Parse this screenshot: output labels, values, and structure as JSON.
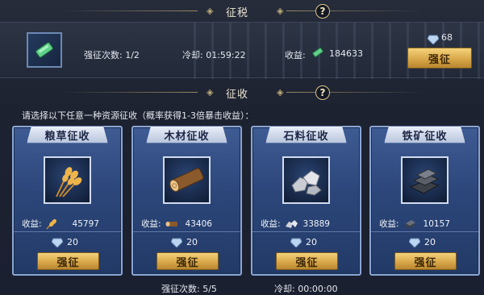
{
  "tax_section": {
    "title": "征税",
    "help_label": "?",
    "count_label": "强征次数: 1/2",
    "cooldown_label": "冷却: 01:59:22",
    "income_label": "收益:",
    "income_value": "184633",
    "cost_value": "68",
    "button_label": "强征",
    "icon": "silver-ingot-icon"
  },
  "levy_section": {
    "title": "征收",
    "help_label": "?",
    "prompt": "请选择以下任意一种资源征收（概率获得1-3倍暴击收益）：",
    "cards": [
      {
        "title": "粮草征收",
        "yield_label": "收益:",
        "yield_value": "45797",
        "cost": "20",
        "button_label": "强征",
        "icon": "wheat-icon"
      },
      {
        "title": "木材征收",
        "yield_label": "收益:",
        "yield_value": "43406",
        "cost": "20",
        "button_label": "强征",
        "icon": "wood-log-icon"
      },
      {
        "title": "石料征收",
        "yield_label": "收益:",
        "yield_value": "33889",
        "cost": "20",
        "button_label": "强征",
        "icon": "stone-icon"
      },
      {
        "title": "铁矿征收",
        "yield_label": "收益:",
        "yield_value": "10157",
        "cost": "20",
        "button_label": "强征",
        "icon": "iron-ingot-icon"
      }
    ],
    "footer_count": "强征次数: 5/5",
    "footer_cooldown": "冷却: 00:00:00"
  },
  "colors": {
    "gold": "#d9a84a",
    "card_blue": "#2c467a",
    "panel": "#1d2230"
  }
}
